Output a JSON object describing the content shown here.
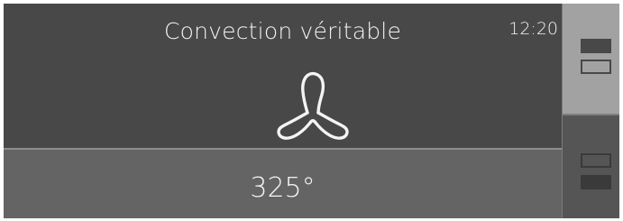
{
  "mode": {
    "title": "Convection véritable",
    "icon": "fan-icon"
  },
  "clock": {
    "time": "12:20"
  },
  "temperature": {
    "value": "325°"
  },
  "cavity_selector": {
    "upper": {
      "icon": "upper-oven-icon",
      "selected": true
    },
    "lower": {
      "icon": "lower-oven-icon",
      "selected": false
    }
  },
  "colors": {
    "main_top_bg": "#484848",
    "main_bottom_bg": "#646464",
    "selected_tab_bg": "#a2a2a2",
    "unselected_tab_bg": "#555555",
    "text": "#f2f2f2"
  }
}
